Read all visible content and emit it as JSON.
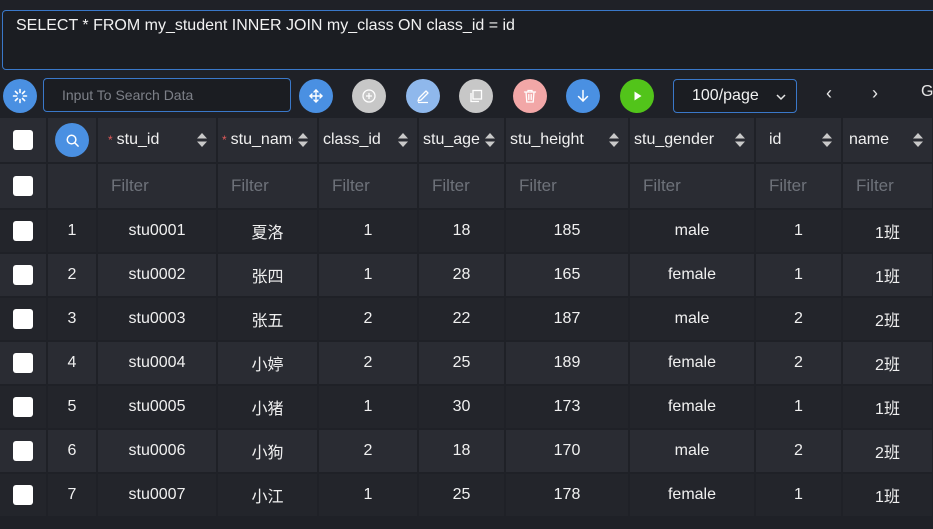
{
  "sql": {
    "query": "SELECT * FROM my_student INNER JOIN my_class ON class_id = id"
  },
  "toolbar": {
    "search_placeholder": "Input To Search Data",
    "page_size": "100/page",
    "prev": "‹",
    "next": "›",
    "goto": "G",
    "colors": {
      "refresh": "#4a90e2",
      "move": "#4a90e2",
      "add": "#c7c7c7",
      "edit": "#8fb8ec",
      "copy": "#c7c7c7",
      "delete": "#f2a7a7",
      "download": "#4a90e2",
      "run": "#52c41a"
    }
  },
  "table": {
    "filter_placeholder": "Filter",
    "columns": [
      {
        "key": "stu_id",
        "label": "stu_id",
        "required": true
      },
      {
        "key": "stu_name",
        "label": "stu_name",
        "required": true
      },
      {
        "key": "class_id",
        "label": "class_id",
        "required": false
      },
      {
        "key": "stu_age",
        "label": "stu_age",
        "required": false
      },
      {
        "key": "stu_height",
        "label": "stu_height",
        "required": false
      },
      {
        "key": "stu_gender",
        "label": "stu_gender",
        "required": false
      },
      {
        "key": "id",
        "label": "id",
        "required": false
      },
      {
        "key": "name",
        "label": "name",
        "required": false
      }
    ],
    "rows": [
      {
        "no": "1",
        "stu_id": "stu0001",
        "stu_name": "夏洛",
        "class_id": "1",
        "stu_age": "18",
        "stu_height": "185",
        "stu_gender": "male",
        "id": "1",
        "name": "1班"
      },
      {
        "no": "2",
        "stu_id": "stu0002",
        "stu_name": "张四",
        "class_id": "1",
        "stu_age": "28",
        "stu_height": "165",
        "stu_gender": "female",
        "id": "1",
        "name": "1班"
      },
      {
        "no": "3",
        "stu_id": "stu0003",
        "stu_name": "张五",
        "class_id": "2",
        "stu_age": "22",
        "stu_height": "187",
        "stu_gender": "male",
        "id": "2",
        "name": "2班"
      },
      {
        "no": "4",
        "stu_id": "stu0004",
        "stu_name": "小婷",
        "class_id": "2",
        "stu_age": "25",
        "stu_height": "189",
        "stu_gender": "female",
        "id": "2",
        "name": "2班"
      },
      {
        "no": "5",
        "stu_id": "stu0005",
        "stu_name": "小猪",
        "class_id": "1",
        "stu_age": "30",
        "stu_height": "173",
        "stu_gender": "female",
        "id": "1",
        "name": "1班"
      },
      {
        "no": "6",
        "stu_id": "stu0006",
        "stu_name": "小狗",
        "class_id": "2",
        "stu_age": "18",
        "stu_height": "170",
        "stu_gender": "male",
        "id": "2",
        "name": "2班"
      },
      {
        "no": "7",
        "stu_id": "stu0007",
        "stu_name": "小江",
        "class_id": "1",
        "stu_age": "25",
        "stu_height": "178",
        "stu_gender": "female",
        "id": "1",
        "name": "1班"
      }
    ]
  }
}
